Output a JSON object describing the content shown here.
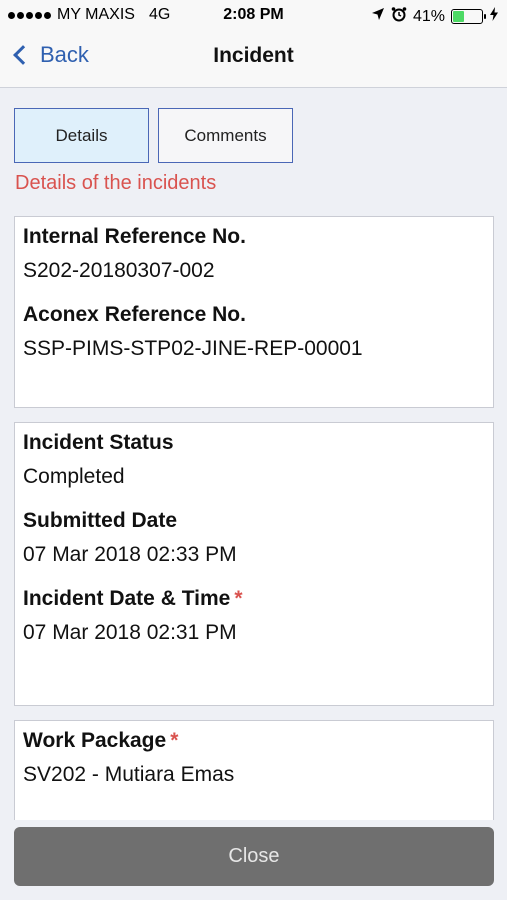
{
  "status_bar": {
    "carrier": "MY MAXIS",
    "network": "4G",
    "time": "2:08 PM",
    "battery": "41%",
    "battery_level": 0.41
  },
  "nav": {
    "back_label": "Back",
    "title": "Incident"
  },
  "tabs": [
    {
      "label": "Details",
      "active": true
    },
    {
      "label": "Comments",
      "active": false
    }
  ],
  "section_heading": "Details of the incidents",
  "card1": {
    "internal_ref_label": "Internal Reference No.",
    "internal_ref_value": "S202-20180307-002",
    "aconex_ref_label": "Aconex Reference No.",
    "aconex_ref_value": "SSP-PIMS-STP02-JINE-REP-00001"
  },
  "card2": {
    "status_label": "Incident Status",
    "status_value": "Completed",
    "submitted_label": "Submitted Date",
    "submitted_value": "07 Mar 2018 02:33 PM",
    "incident_dt_label": "Incident Date & Time",
    "incident_dt_value": "07 Mar 2018 02:31 PM"
  },
  "card3": {
    "work_package_label": "Work Package",
    "work_package_value": "SV202 - Mutiara Emas"
  },
  "required_marker": "*",
  "close_label": "Close",
  "colors": {
    "accent": "#2f60b0",
    "required": "#d9534f",
    "close_button": "#6f6f6f"
  }
}
